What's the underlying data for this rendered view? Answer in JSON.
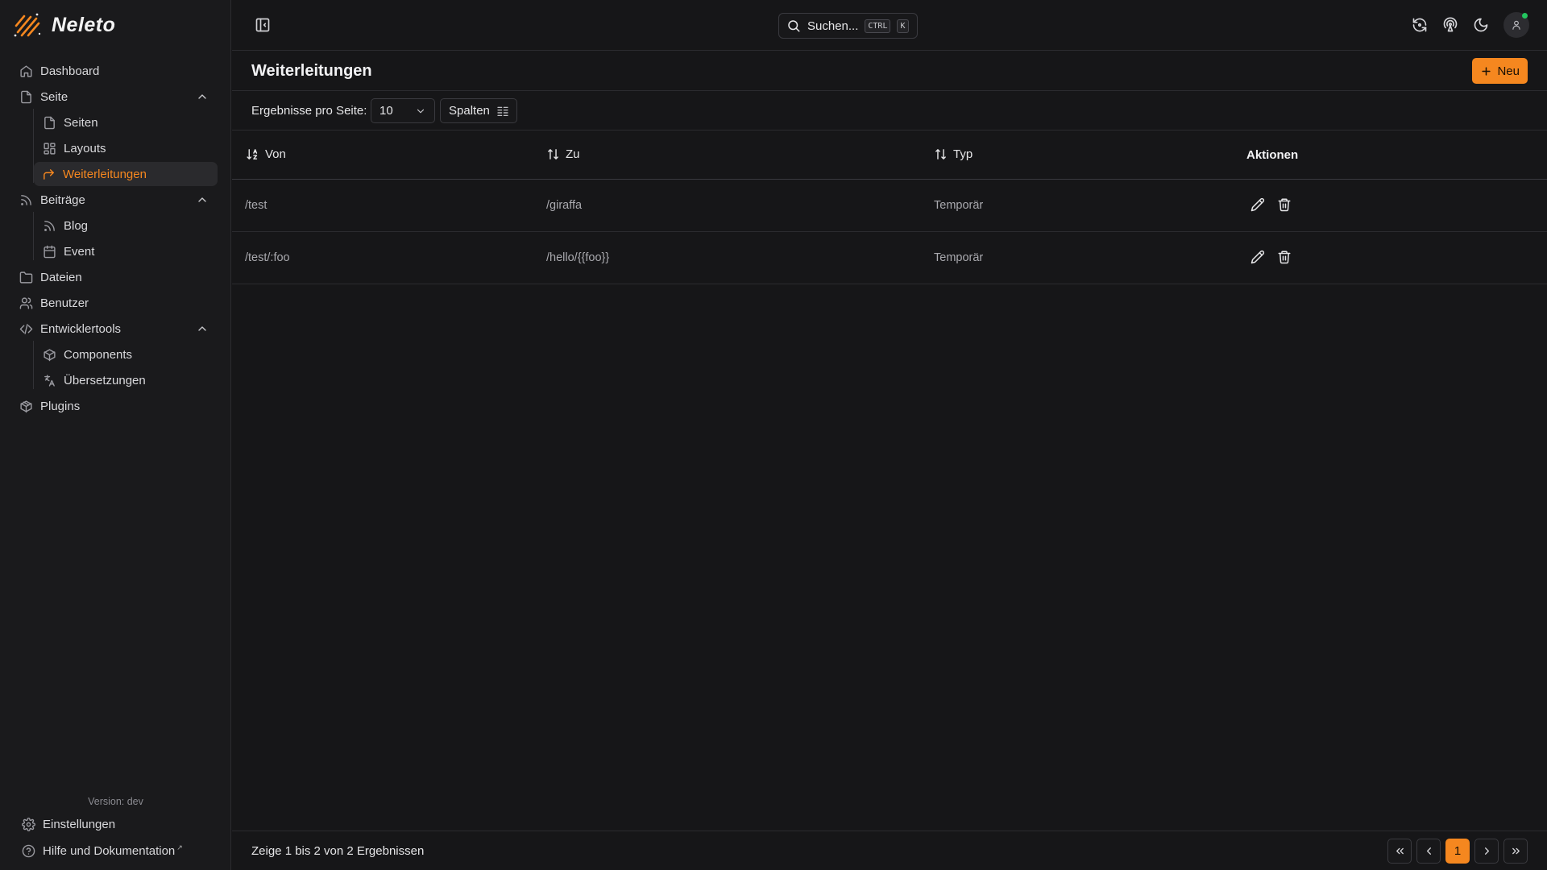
{
  "app": {
    "name": "Neleto"
  },
  "sidebar": {
    "items": [
      {
        "label": "Dashboard",
        "icon": "home-icon"
      },
      {
        "label": "Seite",
        "icon": "file-icon"
      },
      {
        "label": "Seiten",
        "icon": "file-icon"
      },
      {
        "label": "Layouts",
        "icon": "layout-icon"
      },
      {
        "label": "Weiterleitungen",
        "icon": "redirect-icon",
        "active": true
      },
      {
        "label": "Beiträge",
        "icon": "rss-icon"
      },
      {
        "label": "Blog",
        "icon": "rss-icon"
      },
      {
        "label": "Event",
        "icon": "calendar-icon"
      },
      {
        "label": "Dateien",
        "icon": "folder-icon"
      },
      {
        "label": "Benutzer",
        "icon": "users-icon"
      },
      {
        "label": "Entwicklertools",
        "icon": "code-icon"
      },
      {
        "label": "Components",
        "icon": "box-icon"
      },
      {
        "label": "Übersetzungen",
        "icon": "languages-icon"
      },
      {
        "label": "Plugins",
        "icon": "package-icon"
      }
    ],
    "version": "Version: dev",
    "footer": {
      "settings": "Einstellungen",
      "help": "Hilfe und Dokumentation",
      "help_ext": "↗"
    }
  },
  "topbar": {
    "search_label": "Suchen...",
    "shortcut_ctrl": "CTRL",
    "shortcut_k": "K"
  },
  "page": {
    "title": "Weiterleitungen",
    "new_button": "Neu",
    "accent_color": "#f5871f"
  },
  "toolbar": {
    "per_page_label": "Ergebnisse pro Seite:",
    "per_page_value": "10",
    "columns_button": "Spalten"
  },
  "table": {
    "headers": {
      "from": "Von",
      "to": "Zu",
      "type": "Typ",
      "actions": "Aktionen"
    },
    "rows": [
      {
        "from": "/test",
        "to": "/giraffa",
        "type": "Temporär"
      },
      {
        "from": "/test/:foo",
        "to": "/hello/{{foo}}",
        "type": "Temporär"
      }
    ]
  },
  "footer": {
    "summary": "Zeige 1 bis 2 von 2 Ergebnissen",
    "current_page": "1"
  }
}
